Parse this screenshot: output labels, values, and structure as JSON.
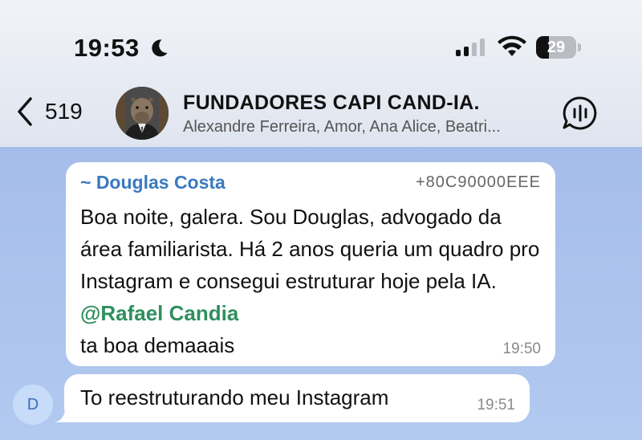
{
  "status_bar": {
    "time": "19:53",
    "battery_level": "29",
    "icons": [
      "moon-icon",
      "cellular-signal-icon",
      "wifi-icon",
      "battery-icon"
    ]
  },
  "nav": {
    "back_count": "519",
    "chat_title": "FUNDADORES CAPI CAND-IA.",
    "chat_members": "Alexandre Ferreira, Amor, Ana Alice, Beatri...",
    "icons": [
      "chevron-left-icon",
      "group-avatar",
      "voice-chat-icon"
    ]
  },
  "messages": [
    {
      "sender": "~ Douglas Costa",
      "sender_phone": "+80C90000EEE",
      "text_before_mention": "Boa noite, galera. Sou Douglas, advogado da área familiarista. Há 2 anos queria um quadro pro Instagram e consegui estruturar hoje pela IA. ",
      "mention": "@Rafael Candia",
      "text_after_mention": "ta boa demaaais",
      "time": "19:50"
    },
    {
      "avatar_letter": "D",
      "text": "To reestruturando meu Instagram",
      "time": "19:51"
    }
  ],
  "colors": {
    "sender_name": "#3a79c0",
    "mention": "#2f8f5e",
    "chat_background": "#a9c1ec"
  }
}
